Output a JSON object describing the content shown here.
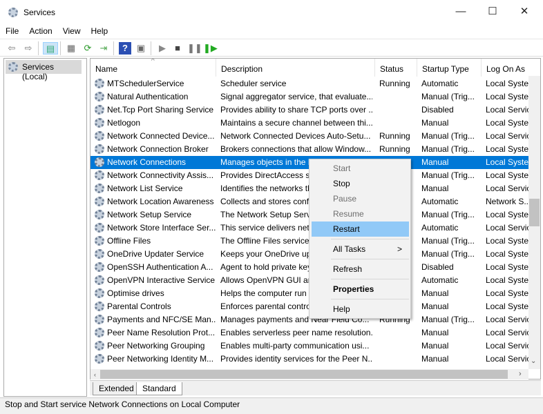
{
  "window": {
    "title": "Services",
    "minimize": "—",
    "maximize": "☐",
    "close": "✕"
  },
  "menu": [
    "File",
    "Action",
    "View",
    "Help"
  ],
  "toolbar": [
    "back-icon",
    "forward-icon",
    "show-hide-console-tree-icon",
    "properties-icon",
    "refresh-icon",
    "export-list-icon",
    "help-icon",
    "show-action-pane-icon",
    "start-service-icon",
    "stop-service-icon",
    "pause-service-icon",
    "restart-service-icon"
  ],
  "tree": {
    "root": "Services (Local)"
  },
  "columns": [
    "Name",
    "Description",
    "Status",
    "Startup Type",
    "Log On As"
  ],
  "sort_indicator": "^",
  "rows": [
    [
      "MTSchedulerService",
      "Scheduler service",
      "Running",
      "Automatic",
      "Local Syste..."
    ],
    [
      "Natural Authentication",
      "Signal aggregator service, that evaluate...",
      "",
      "Manual (Trig...",
      "Local Syste..."
    ],
    [
      "Net.Tcp Port Sharing Service",
      "Provides ability to share TCP ports over ...",
      "",
      "Disabled",
      "Local Servic"
    ],
    [
      "Netlogon",
      "Maintains a secure channel between thi...",
      "",
      "Manual",
      "Local Syste..."
    ],
    [
      "Network Connected Device...",
      "Network Connected Devices Auto-Setu...",
      "Running",
      "Manual (Trig...",
      "Local Servic"
    ],
    [
      "Network Connection Broker",
      "Brokers connections that allow Window...",
      "Running",
      "Manual (Trig...",
      "Local Syste..."
    ],
    [
      "Network Connections",
      "Manages objects in the N",
      "",
      "Manual",
      "Local Syste..."
    ],
    [
      "Network Connectivity Assis...",
      "Provides DirectAccess sta",
      "",
      "Manual (Trig...",
      "Local Syste..."
    ],
    [
      "Network List Service",
      "Identifies the networks th",
      "",
      "Manual",
      "Local Servic"
    ],
    [
      "Network Location Awareness",
      "Collects and stores confi",
      "",
      "Automatic",
      "Network S..."
    ],
    [
      "Network Setup Service",
      "The Network Setup Servic",
      "",
      "Manual (Trig...",
      "Local Syste..."
    ],
    [
      "Network Store Interface Ser...",
      "This service delivers netw",
      "",
      "Automatic",
      "Local Servic"
    ],
    [
      "Offline Files",
      "The Offline Files service p",
      "",
      "Manual (Trig...",
      "Local Syste..."
    ],
    [
      "OneDrive Updater Service",
      "Keeps your OneDrive up",
      "",
      "Manual (Trig...",
      "Local Syste..."
    ],
    [
      "OpenSSH Authentication A...",
      "Agent to hold private key",
      "",
      "Disabled",
      "Local Syste..."
    ],
    [
      "OpenVPN Interactive Service",
      "Allows OpenVPN GUI and",
      "",
      "Automatic",
      "Local Syste..."
    ],
    [
      "Optimise drives",
      "Helps the computer run",
      "",
      "Manual",
      "Local Syste..."
    ],
    [
      "Parental Controls",
      "Enforces parental contro",
      "",
      "Manual",
      "Local Syste..."
    ],
    [
      "Payments and NFC/SE Man...",
      "Manages payments and Near Field Co...",
      "Running",
      "Manual (Trig...",
      "Local Servic"
    ],
    [
      "Peer Name Resolution Prot...",
      "Enables serverless peer name resolution...",
      "",
      "Manual",
      "Local Servic"
    ],
    [
      "Peer Networking Grouping",
      "Enables multi-party communication usi...",
      "",
      "Manual",
      "Local Servic"
    ],
    [
      "Peer Networking Identity M...",
      "Provides identity services for the Peer N...",
      "",
      "Manual",
      "Local Servic"
    ]
  ],
  "selected_row": 6,
  "context_menu": {
    "items": [
      {
        "label": "Start",
        "disabled": true
      },
      {
        "label": "Stop"
      },
      {
        "label": "Pause",
        "disabled": true
      },
      {
        "label": "Resume",
        "disabled": true
      },
      {
        "label": "Restart",
        "highlighted": true
      },
      {
        "label": "All Tasks",
        "submenu": ">"
      },
      {
        "label": "Refresh"
      },
      {
        "label": "Properties",
        "bold": true
      },
      {
        "label": "Help"
      }
    ]
  },
  "tabs": [
    "Extended",
    "Standard"
  ],
  "active_tab": "Standard",
  "status_text": "Stop and Start service Network Connections on Local Computer",
  "colors": {
    "selection": "#0078d7",
    "menu_highlight": "#91c9f7"
  }
}
